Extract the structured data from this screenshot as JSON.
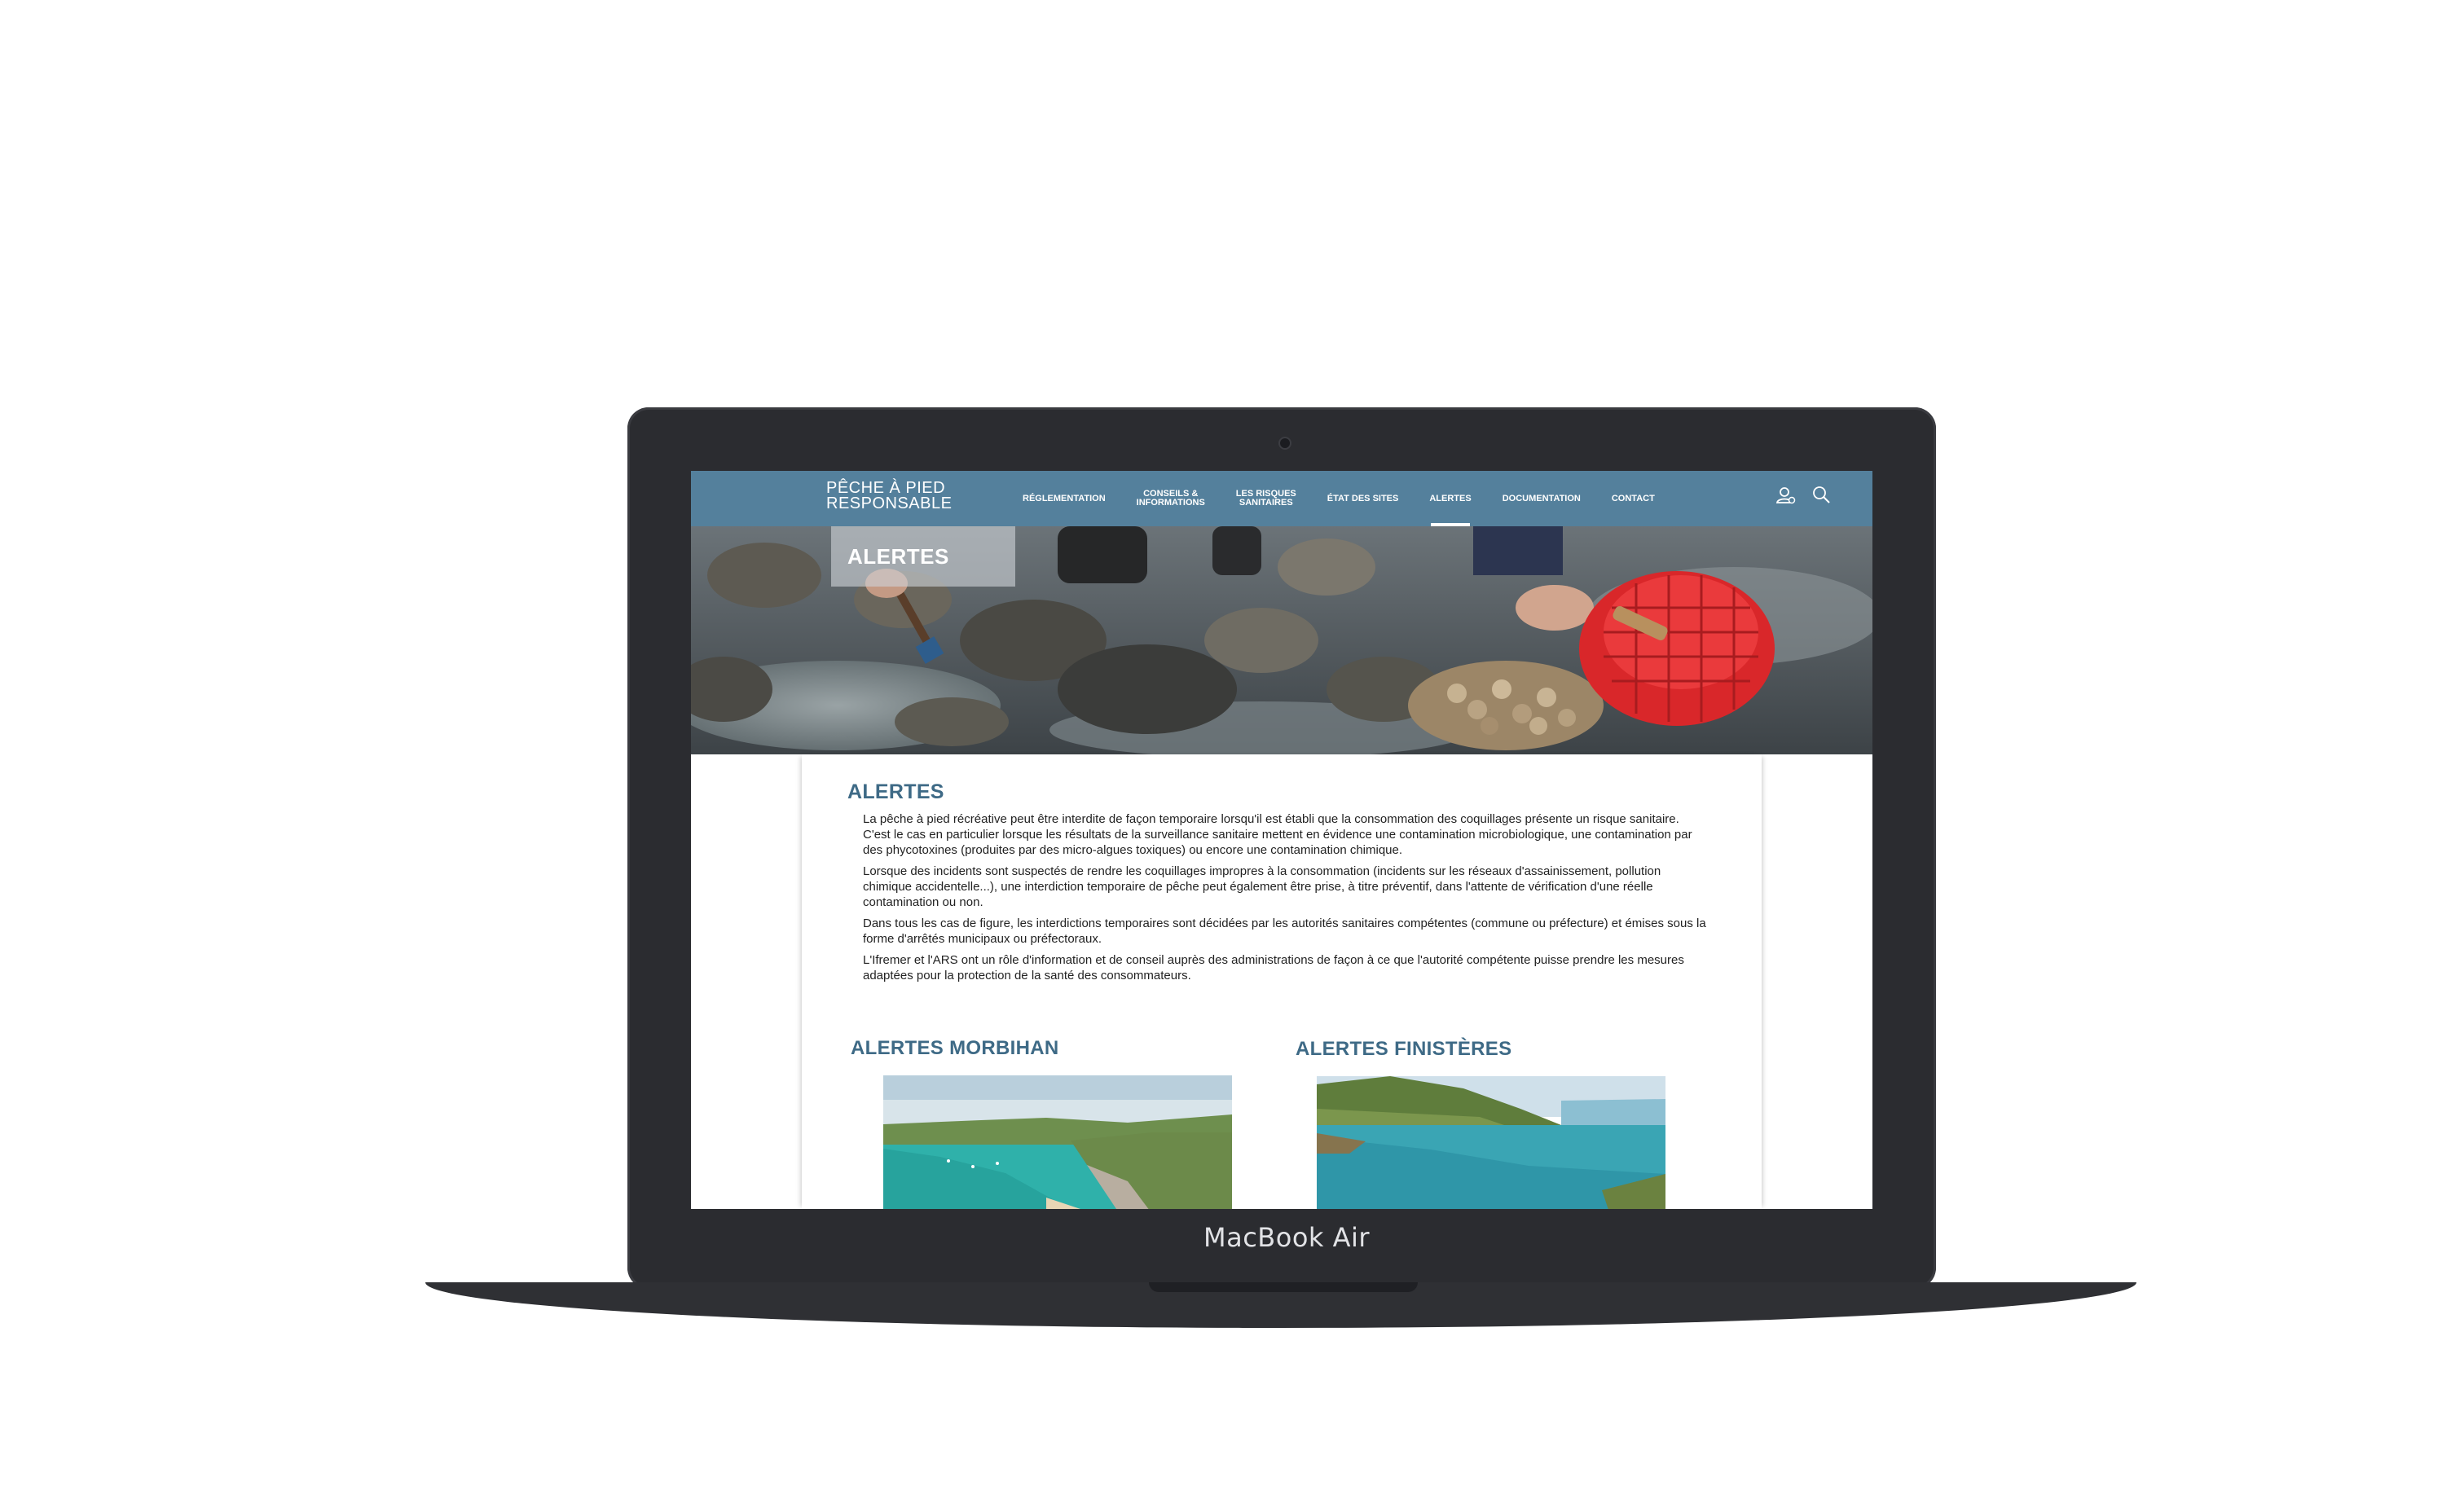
{
  "device": {
    "brand_label": "MacBook Air"
  },
  "site": {
    "logo_line1": "PÊCHE À PIED",
    "logo_line2": "RESPONSABLE",
    "nav": [
      {
        "label": "RÉGLEMENTATION",
        "active": false
      },
      {
        "label": "CONSEILS &",
        "label2": "INFORMATIONS",
        "active": false
      },
      {
        "label": "LES RISQUES",
        "label2": "SANITAIRES",
        "active": false
      },
      {
        "label": "ÉTAT DES SITES",
        "active": false
      },
      {
        "label": "ALERTES",
        "active": true
      },
      {
        "label": "DOCUMENTATION",
        "active": false
      },
      {
        "label": "CONTACT",
        "active": false
      }
    ],
    "icons": [
      "user-icon",
      "search-icon"
    ],
    "nav_color": "#54809c",
    "accent_color": "#3e6a86"
  },
  "hero": {
    "badge": "ALERTES"
  },
  "main": {
    "title": "ALERTES",
    "paragraphs": [
      "La pêche à pied récréative peut être interdite de façon temporaire lorsqu'il est établi que la consommation des coquillages présente un risque sanitaire. C'est le cas en particulier lorsque les résultats de la surveillance  sanitaire mettent en évidence une contamination microbiologique, une contamination par des phycotoxines (produites par des micro-algues toxiques) ou encore une contamination chimique.",
      "Lorsque des incidents sont suspectés de rendre les coquillages impropres à la consommation (incidents sur les réseaux d'assainissement, pollution chimique accidentelle...), une interdiction temporaire de pêche peut également être prise, à titre préventif, dans l'attente de vérification d'une réelle contamination ou non.",
      "Dans tous les cas de figure, les interdictions temporaires sont décidées par les autorités sanitaires compétentes (commune ou préfecture) et émises sous la forme d'arrêtés municipaux ou préfectoraux.",
      "L'Ifremer et l'ARS ont un rôle d'information et de conseil auprès des administrations de façon à ce que l'autorité compétente puisse prendre  les mesures adaptées pour la protection de la santé des consommateurs."
    ],
    "regions": [
      {
        "title": "ALERTES MORBIHAN"
      },
      {
        "title": "ALERTES FINISTÈRES"
      }
    ]
  }
}
